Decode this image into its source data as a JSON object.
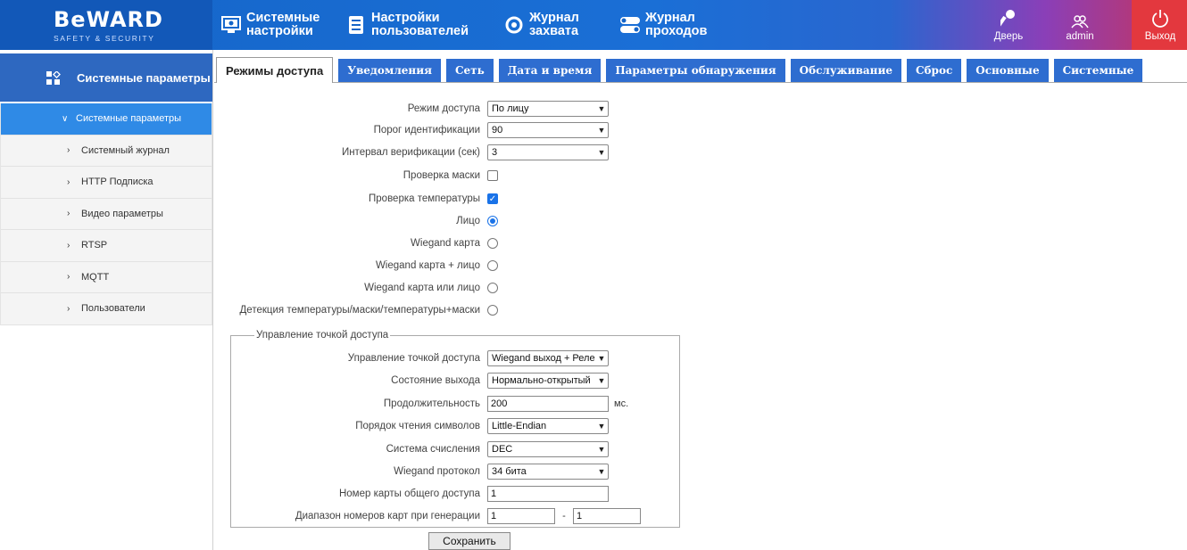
{
  "brand": {
    "name": "BeWARD",
    "tagline": "SAFETY & SECURITY"
  },
  "nav": [
    {
      "line1": "Системные",
      "line2": "настройки",
      "icon": "monitor-gear-icon"
    },
    {
      "line1": "Настройки",
      "line2": "пользователей",
      "icon": "document-list-icon"
    },
    {
      "line1": "Журнал",
      "line2": "захвата",
      "icon": "target-icon"
    },
    {
      "line1": "Журнал",
      "line2": "проходов",
      "icon": "toggle-icon"
    }
  ],
  "topbar": {
    "door": "Дверь",
    "user": "admin",
    "exit": "Выход"
  },
  "sidebar": {
    "title": "Системные параметры",
    "items": [
      {
        "label": "Системные параметры",
        "chev": "∨"
      },
      {
        "label": "Системный журнал",
        "chev": "›"
      },
      {
        "label": "HTTP Подписка",
        "chev": "›"
      },
      {
        "label": "Видео параметры",
        "chev": "›"
      },
      {
        "label": "RTSP",
        "chev": "›"
      },
      {
        "label": "MQTT",
        "chev": "›"
      },
      {
        "label": "Пользователи",
        "chev": "›"
      }
    ]
  },
  "tabs": [
    "Режимы доступа",
    "Уведомления",
    "Сеть",
    "Дата и время",
    "Параметры обнаружения",
    "Обслуживание",
    "Сброс",
    "Основные",
    "Системные"
  ],
  "form": {
    "access_mode": {
      "label": "Режим доступа",
      "value": "По лицу"
    },
    "threshold": {
      "label": "Порог идентификации",
      "value": "90"
    },
    "verify_interval": {
      "label": "Интервал верификации (сек)",
      "value": "3"
    },
    "mask_check": {
      "label": "Проверка маски",
      "checked": false
    },
    "temp_check": {
      "label": "Проверка температуры",
      "checked": true
    },
    "mode_face": {
      "label": "Лицо",
      "selected": true
    },
    "mode_wiegand": {
      "label": "Wiegand карта",
      "selected": false
    },
    "mode_wiegand_and_face": {
      "label": "Wiegand карта + лицо",
      "selected": false
    },
    "mode_wiegand_or_face": {
      "label": "Wiegand карта или лицо",
      "selected": false
    },
    "mode_detect": {
      "label": "Детекция температуры/маски/температуры+маски",
      "selected": false
    }
  },
  "access_point": {
    "legend": "Управление точкой доступа",
    "control": {
      "label": "Управление точкой доступа",
      "value": "Wiegand выход + Реле"
    },
    "output_state": {
      "label": "Состояние выхода",
      "value": "Нормально-открытый"
    },
    "duration": {
      "label": "Продолжительность",
      "value": "200",
      "unit": "мс."
    },
    "byte_order": {
      "label": "Порядок чтения символов",
      "value": "Little-Endian"
    },
    "number_system": {
      "label": "Система счисления",
      "value": "DEC"
    },
    "wiegand_protocol": {
      "label": "Wiegand протокол",
      "value": "34 бита"
    },
    "public_card": {
      "label": "Номер карты общего доступа",
      "value": "1"
    },
    "card_range": {
      "label": "Диапазон номеров карт при генерации",
      "from": "1",
      "sep": "-",
      "to": "1"
    }
  },
  "save_label": "Сохранить"
}
